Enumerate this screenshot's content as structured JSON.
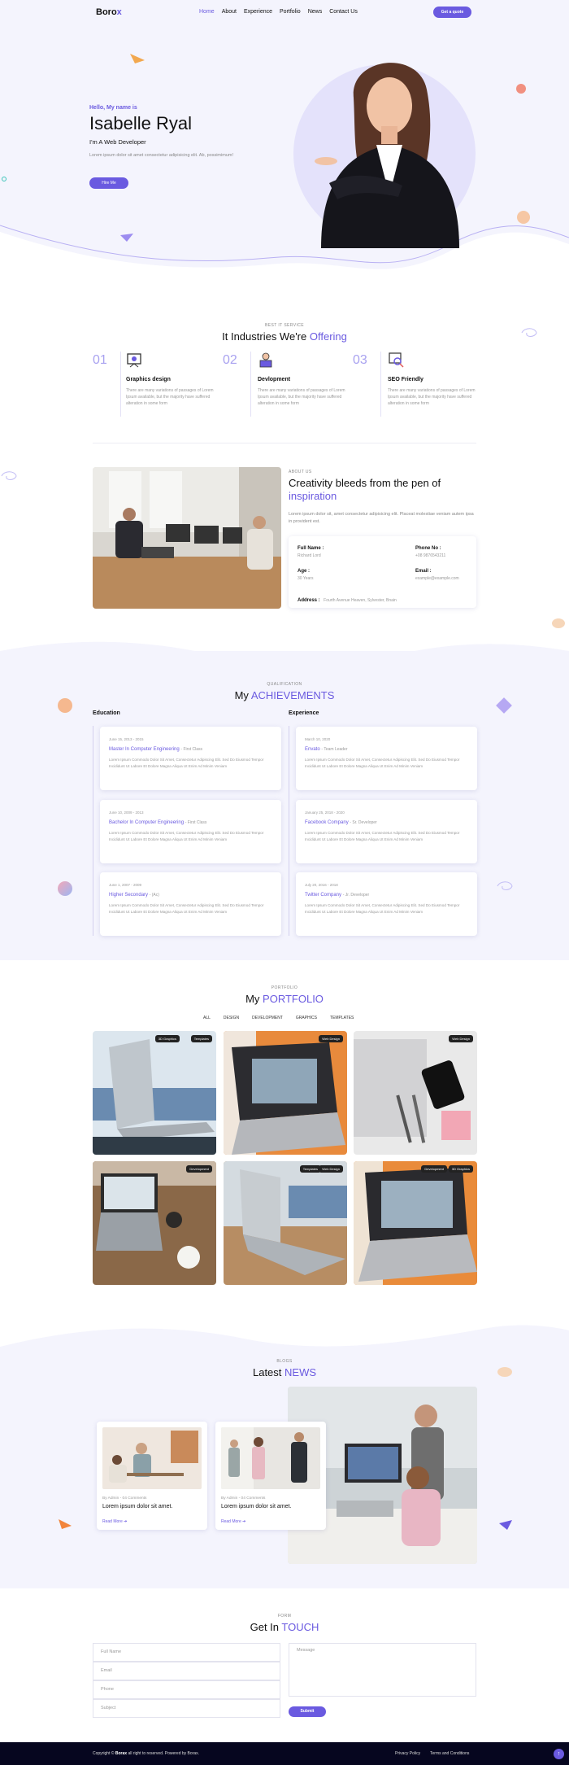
{
  "nav": {
    "logo_main": "Boro",
    "logo_accent": "x",
    "items": [
      "Home",
      "About",
      "Experience",
      "Portfolio",
      "News",
      "Contact Us"
    ],
    "cta": "Get a quote"
  },
  "hero": {
    "greeting": "Hello, My name is",
    "name": "Isabelle Ryal",
    "role": "I'm A Web Developer",
    "desc": "Lorem ipsum dolor sit amet consectetur adipisicing elit. Ab, possimimum!",
    "button": "Hire Me"
  },
  "services": {
    "sub": "BEST IT SERVICE",
    "title_main": "It Industries We're ",
    "title_accent": "Offering",
    "items": [
      {
        "num": "01",
        "title": "Graphics design",
        "desc": "There are many variations of passages of Lorem Ipsum available, but the majority have suffered alteration in some form"
      },
      {
        "num": "02",
        "title": "Devlopment",
        "desc": "There are many variations of passages of Lorem Ipsum available, but the majority have suffered alteration in some form"
      },
      {
        "num": "03",
        "title": "SEO Friendly",
        "desc": "There are many variations of passages of Lorem Ipsum available, but the majority have suffered alteration in some form"
      }
    ]
  },
  "about": {
    "sub": "ABOUT US",
    "title_main": "Creativity bleeds from the pen of ",
    "title_accent": "inspiration",
    "desc": "Lorem ipsum dolor sit, amet consectetur adipisicing elit. Placeat molestiae veniam autem ipsa in provident est.",
    "fullname_label": "Full Name :",
    "fullname": "Richard Lord",
    "phone_label": "Phone No :",
    "phone": "+08 9876543211",
    "age_label": "Age :",
    "age": "30 Years",
    "email_label": "Email :",
    "email": "example@example.com",
    "address_label": "Address :",
    "address": "Fourth Avenue Heaven, Sylvester, Bnain"
  },
  "achievements": {
    "sub": "QUALIFICATION",
    "title_main": "My ",
    "title_accent": "ACHIEVEMENTS",
    "education_title": "Education",
    "experience_title": "Experience",
    "education": [
      {
        "date": "June 15, 2013 - 2015",
        "title": "Master In Computer Engineering",
        "org": "- First Class",
        "desc": "Lorem Ipsum Commodo Dolor Sit Amet, Consectetur Adipiscing Elit. Sed Do Eiusmod Tempor Incididunt Ut Labore Et Dolore Magna Aliqua Ut Enim Ad Minim Veniam"
      },
      {
        "date": "June 10, 2009 - 2013",
        "title": "Bachelor In Computer Engineering",
        "org": "- First Class",
        "desc": "Lorem Ipsum Commodo Dolor Sit Amet, Consectetur Adipiscing Elit. Sed Do Eiusmod Tempor Incididunt Ut Labore Et Dolore Magna Aliqua Ut Enim Ad Minim Veniam"
      },
      {
        "date": "June 1, 2007 - 2009",
        "title": "Higher Secondary",
        "org": "- (Ac)",
        "desc": "Lorem Ipsum Commodo Dolor Sit Amet, Consectetur Adipiscing Elit. Sed Do Eiusmod Tempor Incididunt Ut Labore Et Dolore Magna Aliqua Ut Enim Ad Minim Veniam"
      }
    ],
    "experience": [
      {
        "date": "March 10, 2020",
        "title": "Envato",
        "org": "- Team Leader",
        "desc": "Lorem Ipsum Commodo Dolor Sit Amet, Consectetur Adipiscing Elit. Sed Do Eiusmod Tempor Incididunt Ut Labore Et Dolore Magna Aliqua Ut Enim Ad Minim Veniam"
      },
      {
        "date": "January 25, 2018 - 2020",
        "title": "Facebook Company",
        "org": "- Sr. Developer",
        "desc": "Lorem Ipsum Commodo Dolor Sit Amet, Consectetur Adipiscing Elit. Sed Do Eiusmod Tempor Incididunt Ut Labore Et Dolore Magna Aliqua Ut Enim Ad Minim Veniam"
      },
      {
        "date": "July 20, 2016 - 2018",
        "title": "Twitter Company",
        "org": "- Jr. Developer",
        "desc": "Lorem Ipsum Commodo Dolor Sit Amet, Consectetur Adipiscing Elit. Sed Do Eiusmod Tempor Incididunt Ut Labore Et Dolore Magna Aliqua Ut Enim Ad Minim Veniam"
      }
    ]
  },
  "portfolio": {
    "sub": "PORTFOLIO",
    "title_main": "My ",
    "title_accent": "PORTFOLIO",
    "tabs": [
      "ALL",
      "DESIGN",
      "DEVELOPMENT",
      "GRAPHICS",
      "TEMPLATES"
    ],
    "items": [
      {
        "tags": [
          "3D Graphics",
          "Templates"
        ]
      },
      {
        "tags": [
          "Web Design"
        ]
      },
      {
        "tags": [
          "Web Design"
        ]
      },
      {
        "tags": [
          "Development"
        ]
      },
      {
        "tags": [
          "Templates",
          "Web Design"
        ]
      },
      {
        "tags": [
          "Development",
          "3D Graphics"
        ]
      }
    ]
  },
  "news": {
    "sub": "BLOGS",
    "title_main": "Latest ",
    "title_accent": "NEWS",
    "posts": [
      {
        "meta": "By Admin - 04 Comments",
        "title": "Lorem ipsum dolor sit amet.",
        "link": "Read More"
      },
      {
        "meta": "By Admin - 04 Comments",
        "title": "Lorem ipsum dolor sit amet.",
        "link": "Read More"
      }
    ]
  },
  "contact": {
    "sub": "FORM",
    "title_main": "Get In ",
    "title_accent": "TOUCH",
    "fullname_ph": "Full Name",
    "email_ph": "Email",
    "phone_ph": "Phone",
    "subject_ph": "Subject",
    "message_ph": "Message",
    "submit": "Submit"
  },
  "footer": {
    "copy_pre": "Copyright © ",
    "copy_brand": "Borax",
    "copy_post": " all right to reserved. Powered by Borax.",
    "privacy": "Privacy Policy",
    "terms": "Terms and Conditions"
  },
  "colors": {
    "accent": "#6a5ae0",
    "lavender": "#f4f4fd",
    "footer": "#06061f"
  }
}
